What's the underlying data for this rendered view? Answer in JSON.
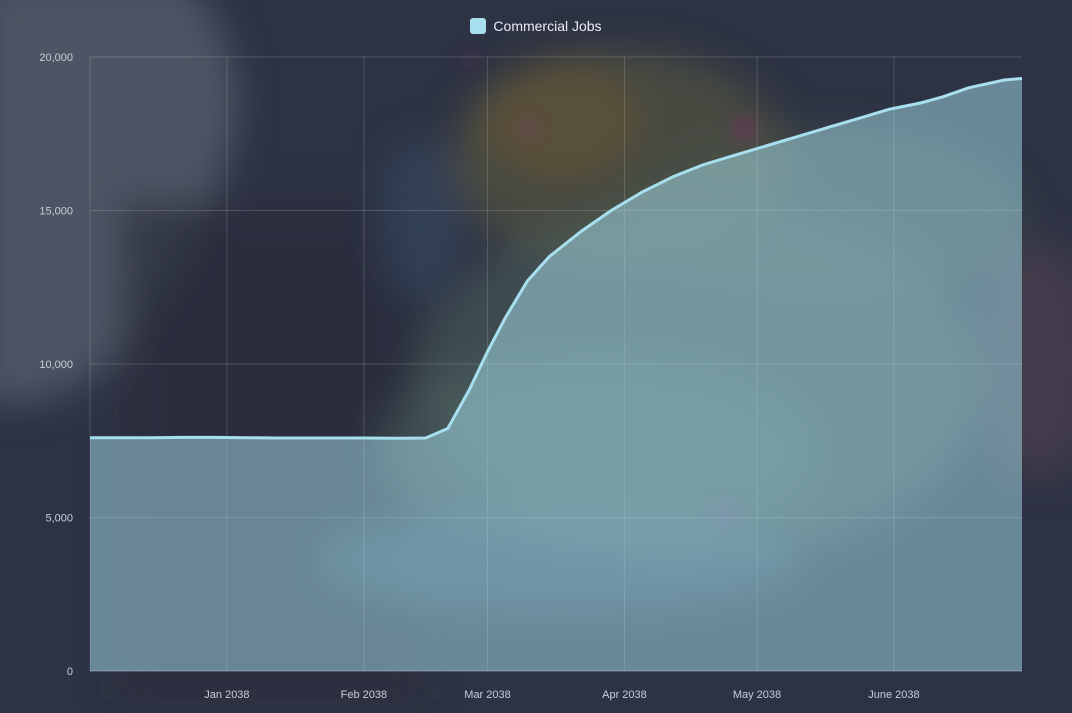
{
  "chart_data": {
    "type": "area",
    "title": "",
    "xlabel": "",
    "ylabel": "",
    "legend_position": "top-center",
    "grid": true,
    "x_tick_labels": [
      "Jan 2038",
      "Feb 2038",
      "Mar 2038",
      "Apr 2038",
      "May 2038",
      "June 2038"
    ],
    "y_tick_labels": [
      "0",
      "5,000",
      "10,000",
      "15,000",
      "20,000"
    ],
    "ylim": [
      0,
      20000
    ],
    "xlim": [
      "2037-12-08",
      "2038-06-21"
    ],
    "series": [
      {
        "name": "Commercial Jobs",
        "color": "#a8dfee",
        "points": [
          [
            "2037-12-08",
            7600
          ],
          [
            "2037-12-15",
            7600
          ],
          [
            "2037-12-22",
            7600
          ],
          [
            "2037-12-29",
            7610
          ],
          [
            "2038-01-05",
            7610
          ],
          [
            "2038-01-12",
            7600
          ],
          [
            "2038-01-19",
            7590
          ],
          [
            "2038-01-26",
            7590
          ],
          [
            "2038-02-02",
            7590
          ],
          [
            "2038-02-09",
            7590
          ],
          [
            "2038-02-16",
            7580
          ],
          [
            "2038-02-22",
            7590
          ],
          [
            "2038-02-27",
            7900
          ],
          [
            "2038-03-04",
            9200
          ],
          [
            "2038-03-08",
            10400
          ],
          [
            "2038-03-12",
            11500
          ],
          [
            "2038-03-17",
            12700
          ],
          [
            "2038-03-22",
            13500
          ],
          [
            "2038-03-29",
            14300
          ],
          [
            "2038-04-05",
            15000
          ],
          [
            "2038-04-12",
            15600
          ],
          [
            "2038-04-19",
            16100
          ],
          [
            "2038-04-26",
            16500
          ],
          [
            "2038-05-03",
            16800
          ],
          [
            "2038-05-10",
            17100
          ],
          [
            "2038-05-17",
            17400
          ],
          [
            "2038-05-24",
            17700
          ],
          [
            "2038-05-31",
            18000
          ],
          [
            "2038-06-07",
            18300
          ],
          [
            "2038-06-14",
            18500
          ],
          [
            "2038-06-19",
            18700
          ],
          [
            "2038-06-25",
            19000
          ],
          [
            "2038-07-03",
            19250
          ],
          [
            "2038-07-07",
            19300
          ]
        ]
      }
    ],
    "x_ticks": [
      [
        "2038-01-08",
        "Jan 2038"
      ],
      [
        "2038-02-08",
        "Feb 2038"
      ],
      [
        "2038-03-08",
        "Mar 2038"
      ],
      [
        "2038-04-08",
        "Apr 2038"
      ],
      [
        "2038-05-08",
        "May 2038"
      ],
      [
        "2038-06-08",
        "June 2038"
      ]
    ],
    "y_ticks": [
      0,
      5000,
      10000,
      15000,
      20000
    ]
  }
}
